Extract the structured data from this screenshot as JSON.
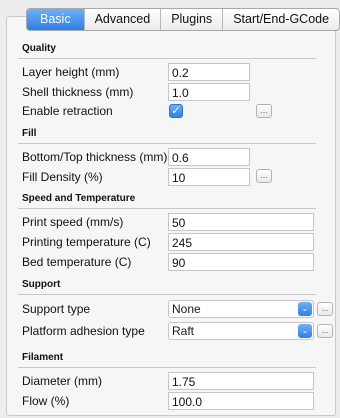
{
  "tabs": [
    {
      "label": "Basic",
      "active": true
    },
    {
      "label": "Advanced",
      "active": false
    },
    {
      "label": "Plugins",
      "active": false
    },
    {
      "label": "Start/End-GCode",
      "active": false
    }
  ],
  "sections": {
    "quality": "Quality",
    "fill": "Fill",
    "speed": "Speed and Temperature",
    "support": "Support",
    "filament": "Filament"
  },
  "quality": {
    "layer_height": {
      "label": "Layer height (mm)",
      "value": "0.2"
    },
    "shell_thickness": {
      "label": "Shell thickness (mm)",
      "value": "1.0"
    },
    "retraction": {
      "label": "Enable retraction",
      "checked": true
    }
  },
  "fill": {
    "bottom_top": {
      "label": "Bottom/Top thickness (mm)",
      "value": "0.6"
    },
    "density": {
      "label": "Fill Density (%)",
      "value": "10"
    }
  },
  "speed": {
    "print_speed": {
      "label": "Print speed (mm/s)",
      "value": "50"
    },
    "print_temp": {
      "label": "Printing temperature (C)",
      "value": "245"
    },
    "bed_temp": {
      "label": "Bed temperature (C)",
      "value": "90"
    }
  },
  "support": {
    "support_type": {
      "label": "Support type",
      "value": "None"
    },
    "adhesion": {
      "label": "Platform adhesion type",
      "value": "Raft"
    }
  },
  "filament": {
    "diameter": {
      "label": "Diameter (mm)",
      "value": "1.75"
    },
    "flow": {
      "label": "Flow (%)",
      "value": "100.0"
    }
  },
  "glyphs": {
    "ellipsis": "...",
    "check": "✓",
    "caret": "⌄"
  },
  "colors": {
    "accent": "#3d8ef0"
  }
}
